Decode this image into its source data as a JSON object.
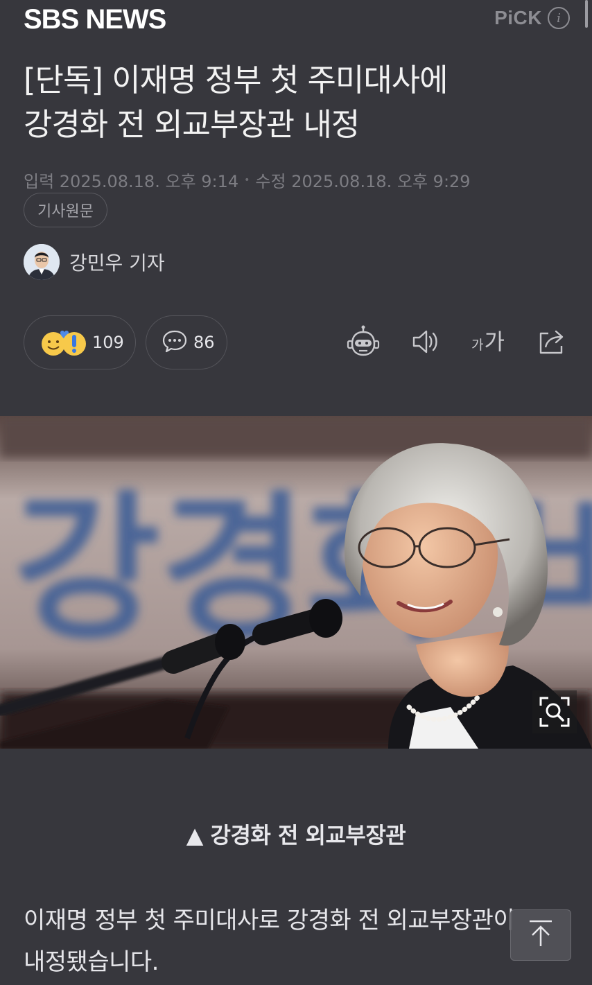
{
  "header": {
    "logo_text": "SBS NEWS",
    "pick_label": "PiCK",
    "info_glyph": "i"
  },
  "article": {
    "headline_line1": "[단독] 이재명 정부 첫 주미대사에",
    "headline_line2": "강경화 전 외교부장관 내정",
    "input_time": "입력 2025.08.18. 오후 9:14",
    "meta_separator": "•",
    "modified_time": "수정 2025.08.18. 오후 9:29",
    "original_button": "기사원문",
    "reporter": "강민우 기자"
  },
  "actions": {
    "reaction_count": "109",
    "comment_count": "86",
    "font_size_small": "가",
    "font_size_large": "가"
  },
  "photo": {
    "banner_text": "강경화 비"
  },
  "caption": "▲ 강경화 전 외교부장관",
  "body": {
    "line1": "이재명 정부 첫 주미대사로 강경화 전 외교부장관이",
    "line2": "내정됐습니다."
  },
  "colors": {
    "background": "#37373d",
    "muted": "#7d7d83",
    "text": "#ececec"
  },
  "icons": [
    "info-icon",
    "reaction-emoji-icon",
    "comment-icon",
    "robot-summary-icon",
    "speaker-icon",
    "font-size-icon",
    "share-icon",
    "zoom-icon",
    "arrow-up-icon"
  ]
}
